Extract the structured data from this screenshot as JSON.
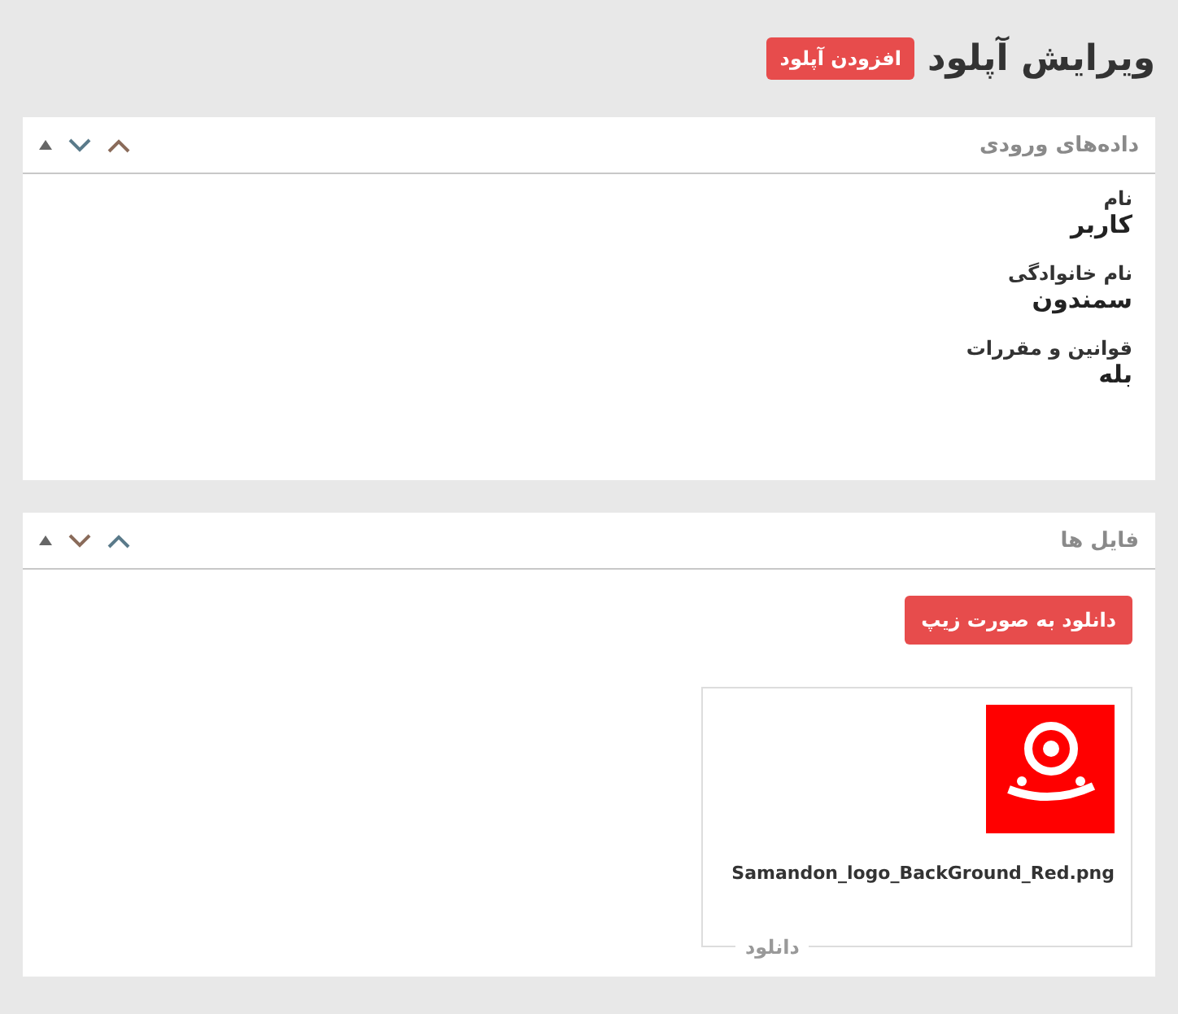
{
  "page": {
    "title": "ویرایش آپلود",
    "add_button": "افزودن آپلود"
  },
  "panels": [
    {
      "kind": "fields",
      "title": "داده‌های ورودی",
      "fields": [
        {
          "label": "نام",
          "value": "کاربر"
        },
        {
          "label": "نام خانوادگی",
          "value": "سمندون"
        },
        {
          "label": "قوانین و مقررات",
          "value": "بله"
        }
      ]
    },
    {
      "kind": "files",
      "title": "فایل ها",
      "zip_button": "دانلود به صورت زیپ",
      "files": [
        {
          "name": "Samandon_logo_BackGround_Red.png",
          "download": "دانلود"
        }
      ]
    }
  ]
}
